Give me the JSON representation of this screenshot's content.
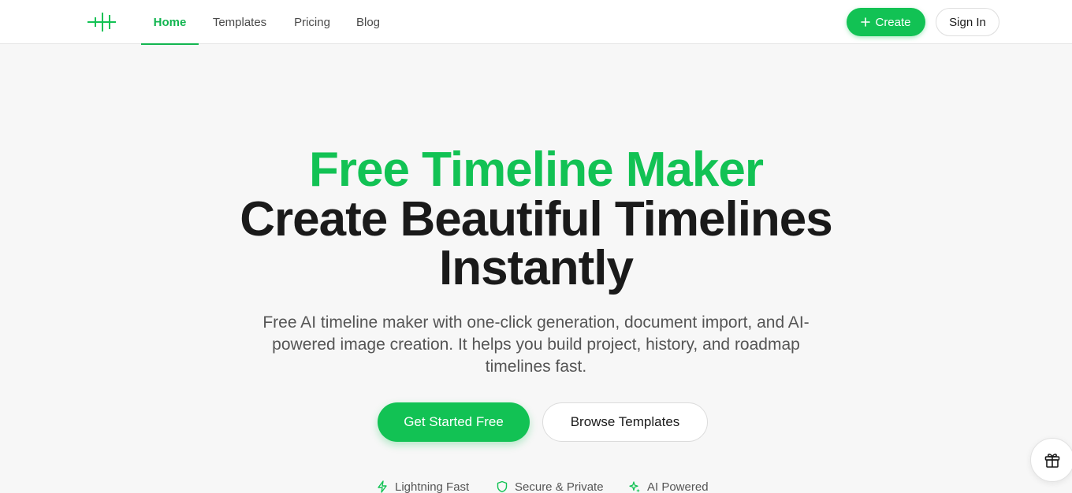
{
  "nav": {
    "items": [
      {
        "label": "Home",
        "active": true
      },
      {
        "label": "Templates",
        "active": false
      },
      {
        "label": "Pricing",
        "active": false
      },
      {
        "label": "Blog",
        "active": false
      }
    ],
    "create_label": "Create",
    "signin_label": "Sign In"
  },
  "hero": {
    "title_line1": "Free Timeline Maker",
    "title_line2": "Create Beautiful Timelines",
    "title_line3": "Instantly",
    "subtitle": "Free AI timeline maker with one-click generation, document import, and AI-powered image creation. It helps you build project, history, and roadmap timelines fast.",
    "primary_cta": "Get Started Free",
    "secondary_cta": "Browse Templates"
  },
  "features": [
    {
      "label": "Lightning Fast",
      "icon": "lightning-icon"
    },
    {
      "label": "Secure & Private",
      "icon": "shield-icon"
    },
    {
      "label": "AI Powered",
      "icon": "sparkles-icon"
    }
  ],
  "colors": {
    "accent": "#12c254",
    "nav_active": "#12b550",
    "background": "#f7f7f7"
  }
}
